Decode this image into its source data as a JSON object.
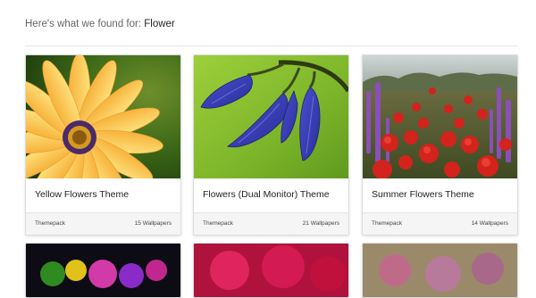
{
  "search": {
    "prefix": "Here's what we found for:",
    "query": "Flower"
  },
  "results": [
    {
      "title": "Yellow Flowers Theme",
      "kind": "Themepack",
      "count": "15 Wallpapers"
    },
    {
      "title": "Flowers (Dual Monitor) Theme",
      "kind": "Themepack",
      "count": "21 Wallpapers"
    },
    {
      "title": "Summer Flowers Theme",
      "kind": "Themepack",
      "count": "14 Wallpapers"
    }
  ],
  "colors": {
    "background": "#ffffff",
    "card_footer": "#f5f5f5",
    "divider": "#e6e6e6"
  }
}
